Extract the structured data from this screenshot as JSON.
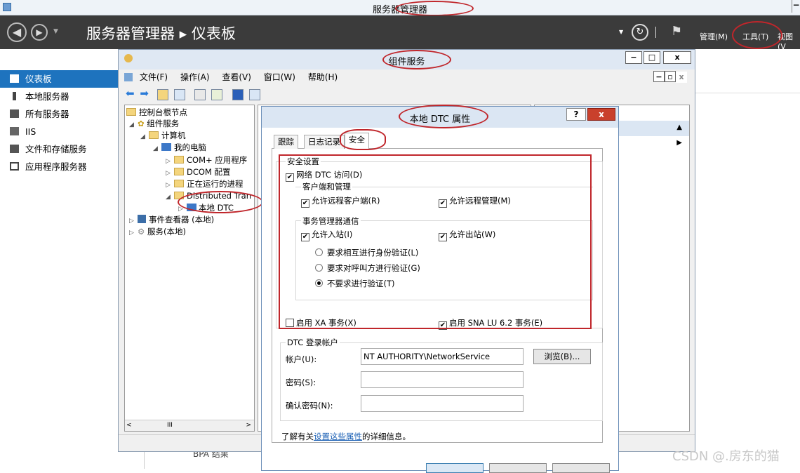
{
  "server_manager": {
    "window_title": "服务器管理器",
    "breadcrumb": "服务器管理器 ▸ 仪表板",
    "menus": [
      "管理(M)",
      "工具(T)",
      "视图(V"
    ],
    "nav": [
      "仪表板",
      "本地服务器",
      "所有服务器",
      "IIS",
      "文件和存储服务",
      "应用程序服务器"
    ],
    "bottom_text": "BPA 结果"
  },
  "component_services": {
    "title": "组件服务",
    "menu": [
      "文件(F)",
      "操作(A)",
      "查看(V)",
      "窗口(W)",
      "帮助(H)"
    ],
    "tree": {
      "root": "控制台根节点",
      "component_services": "组件服务",
      "computers": "计算机",
      "my_computer": "我的电脑",
      "com_plus": "COM+ 应用程序",
      "dcom": "DCOM 配置",
      "running": "正在运行的进程",
      "dtc": "Distributed Tran",
      "local_dtc": "本地 DTC",
      "event_viewer": "事件查看器 (本地)",
      "services": "服务(本地)"
    },
    "scroll_thumb": "III"
  },
  "dialog": {
    "title": "本地 DTC 属性",
    "help": "?",
    "close": "x",
    "tabs": [
      "跟踪",
      "日志记录",
      "安全"
    ],
    "security_group": "安全设置",
    "network_dtc": {
      "label": "网络 DTC 访问(D)",
      "checked": true
    },
    "client_group": "客户端和管理",
    "allow_remote_clients": {
      "label": "允许远程客户端(R)",
      "checked": true
    },
    "allow_remote_admin": {
      "label": "允许远程管理(M)",
      "checked": true
    },
    "tm_group": "事务管理器通信",
    "allow_inbound": {
      "label": "允许入站(I)",
      "checked": true
    },
    "allow_outbound": {
      "label": "允许出站(W)",
      "checked": true
    },
    "auth_options": [
      "要求相互进行身份验证(L)",
      "要求对呼叫方进行验证(G)",
      "不要求进行验证(T)"
    ],
    "auth_selected": 2,
    "enable_xa": {
      "label": "启用 XA 事务(X)",
      "checked": false
    },
    "enable_sna": {
      "label": "启用 SNA LU 6.2 事务(E)",
      "checked": true
    },
    "logon_group": "DTC 登录帐户",
    "account_label": "帐户(U):",
    "account_value": "NT AUTHORITY\\NetworkService",
    "browse": "浏览(B)...",
    "password_label": "密码(S):",
    "confirm_label": "确认密码(N):",
    "info_prefix": "了解有关",
    "info_link": "设置这些属性",
    "info_suffix": "的详细信息。"
  },
  "watermark": "CSDN @.房东的猫",
  "colors": {
    "annotation": "#c0262b",
    "accent": "#1e73be"
  }
}
